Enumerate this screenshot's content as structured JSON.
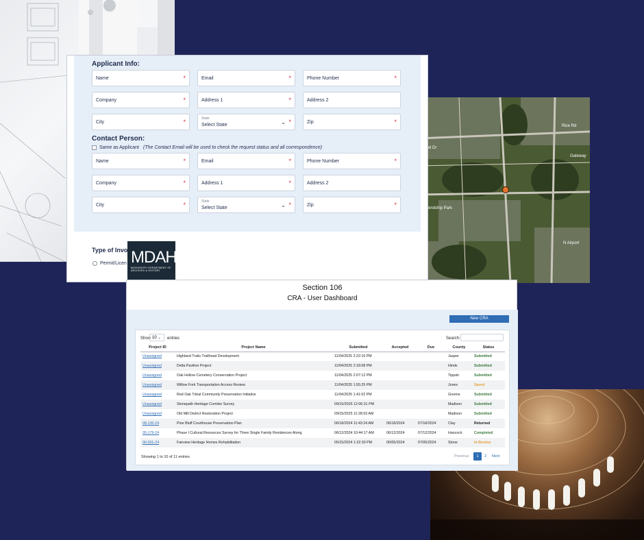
{
  "colors": {
    "navy_bg": "#1f2458",
    "accent_blue": "#2f6db5",
    "required_red": "#d9303e",
    "status_green": "#3a7a3f",
    "status_orange": "#e3a23b"
  },
  "applicant": {
    "title": "Applicant Info:",
    "name": "Name",
    "email": "Email",
    "phone": "Phone Number",
    "company": "Company",
    "address1": "Address 1",
    "address2": "Address 2",
    "city": "City",
    "state_label": "State",
    "state_value": "Select State",
    "zip": "Zip"
  },
  "contact": {
    "title": "Contact Person:",
    "same_label": "Same as Applicant",
    "note": "(The Contact Email will be used to check the request status and all correspondence)",
    "name": "Name",
    "email": "Email",
    "phone": "Phone Number",
    "company": "Company",
    "address1": "Address 1",
    "address2": "Address 2",
    "city": "City",
    "state_label": "State",
    "state_value": "Select State",
    "zip": "Zip"
  },
  "involvement": {
    "title": "Type of Invol",
    "option": "Permit/Licen"
  },
  "required_mark": "*",
  "logo": {
    "text": "MDAH",
    "subtitle": "MISSISSIPPI DEPARTMENT OF ARCHIVES & HISTORY"
  },
  "dashboard": {
    "title": "Section 106",
    "subtitle": "CRA - User Dashboard",
    "new_button": "New CRA",
    "show_label": "Show",
    "show_value": "10",
    "entries_label": "entries",
    "search_label": "Search:",
    "columns": [
      "Project ID",
      "Project Name",
      "Submitted",
      "Accepted",
      "Due",
      "County",
      "Status"
    ],
    "rows": [
      [
        "Unassigned",
        "Highland Trails Trailhead Development",
        "11/04/2025 2:22:16 PM",
        "",
        "",
        "Jasper",
        "Submitted"
      ],
      [
        "Unassigned",
        "Delta Pavilion Project",
        "11/04/2025 2:18:08 PM",
        "",
        "",
        "Hinds",
        "Submitted"
      ],
      [
        "Unassigned",
        "Oak Hollow Cemetery Conservation Project",
        "11/04/2025 2:07:12 PM",
        "",
        "",
        "Tippah",
        "Submitted"
      ],
      [
        "Unassigned",
        "Willow Fork Transportation Access Review",
        "11/04/2025 1:55:25 PM",
        "",
        "",
        "Jones",
        "Saved"
      ],
      [
        "Unassigned",
        "Red Oak Tribal Community Preservation Initiative",
        "11/04/2025 1:41:02 PM",
        "",
        "",
        "Greene",
        "Submitted"
      ],
      [
        "Unassigned",
        "Stonepath Heritage Corridor Survey",
        "09/15/2025 12:06:31 PM",
        "",
        "",
        "Madison",
        "Submitted"
      ],
      [
        "Unassigned",
        "Old Mill District Restoration Project",
        "09/15/2025 11:28:03 AM",
        "",
        "",
        "Madison",
        "Submitted"
      ],
      [
        "08-130-24",
        "Pine Bluff Courthouse Preservation Plan",
        "06/18/2024 11:43:24 AM",
        "06/18/2024",
        "07/18/2024",
        "Clay",
        "Returned"
      ],
      [
        "05-179-24",
        "Phase I Cultural Resources Survey for Three Single Family Residences Along",
        "06/12/2024 10:44:17 AM",
        "06/12/2024",
        "07/12/2024",
        "Hancock",
        "Completed"
      ],
      [
        "06-001-24",
        "Fairview Heritage Homes Rehabilitation",
        "05/15/2024 1:32:30 PM",
        "06/05/2024",
        "07/05/2024",
        "Stone",
        "In Review"
      ]
    ],
    "footer": "Showing 1 to 10 of 11 entries",
    "pager": {
      "prev": "Previous",
      "p1": "1",
      "p2": "2",
      "next": "Next"
    }
  },
  "map_labels": {
    "rice": "Rice Rd",
    "gateway": "Gateway",
    "airport": "N Airport",
    "park": "Friendship Park",
    "wood": "ywood Dr"
  }
}
